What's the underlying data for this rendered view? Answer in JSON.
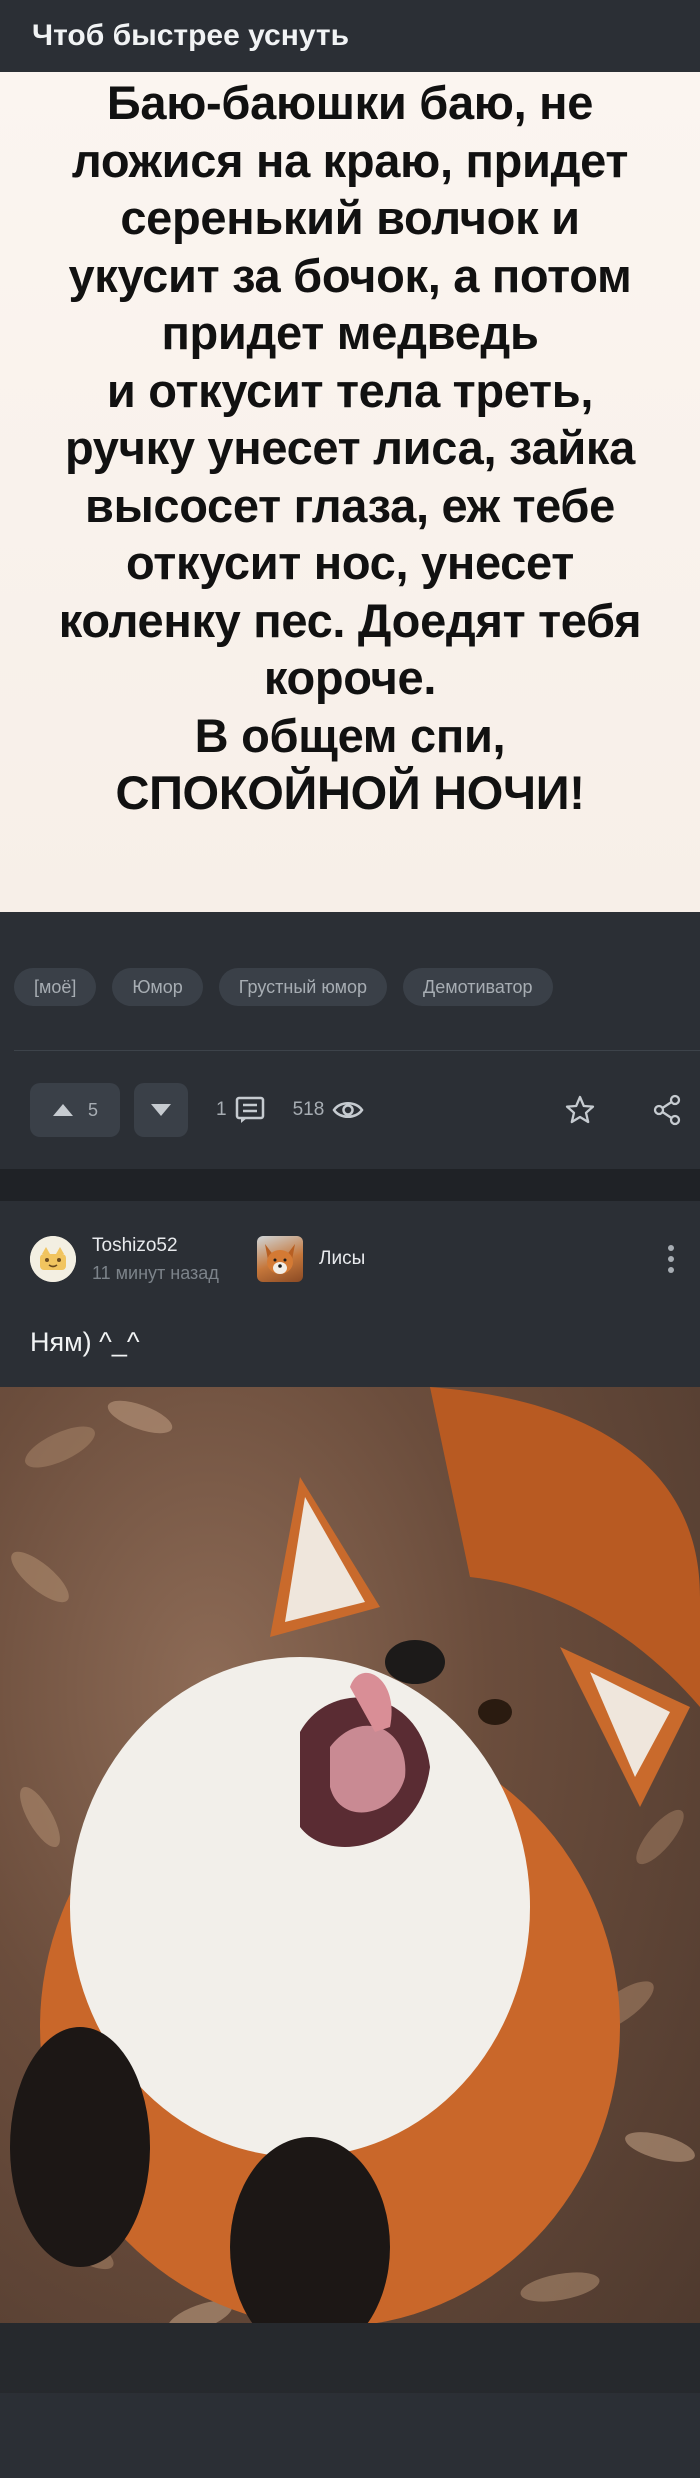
{
  "post1": {
    "title": "Чтоб быстрее уснуть",
    "meme_lines": [
      "Баю-баюшки баю, не",
      "ложися на краю, придет",
      "серенький волчок и",
      "укусит за бочок, а потом",
      "придет медведь",
      "и откусит тела треть,",
      "ручку унесет лиса, зайка",
      "высосет глаза, еж тебе",
      "откусит нос, унесет",
      "коленку пес. Доедят тебя",
      "короче.",
      "В общем спи,",
      "СПОКОЙНОЙ НОЧИ!"
    ],
    "tags": [
      "[моё]",
      "Юмор",
      "Грустный юмор",
      "Демотиватор"
    ],
    "rating": "5",
    "comments_count": "1",
    "views_count": "518"
  },
  "post2": {
    "author_name": "Toshizo52",
    "time_ago": "11 минут назад",
    "community_name": "Лисы",
    "text": "Ням) ^_^"
  },
  "icons": {
    "vote_up": "triangle-up-icon",
    "vote_down": "triangle-down-icon",
    "comments": "comment-icon",
    "views": "eye-icon",
    "bookmark": "star-icon",
    "share": "share-icon",
    "more": "kebab-menu-icon"
  }
}
